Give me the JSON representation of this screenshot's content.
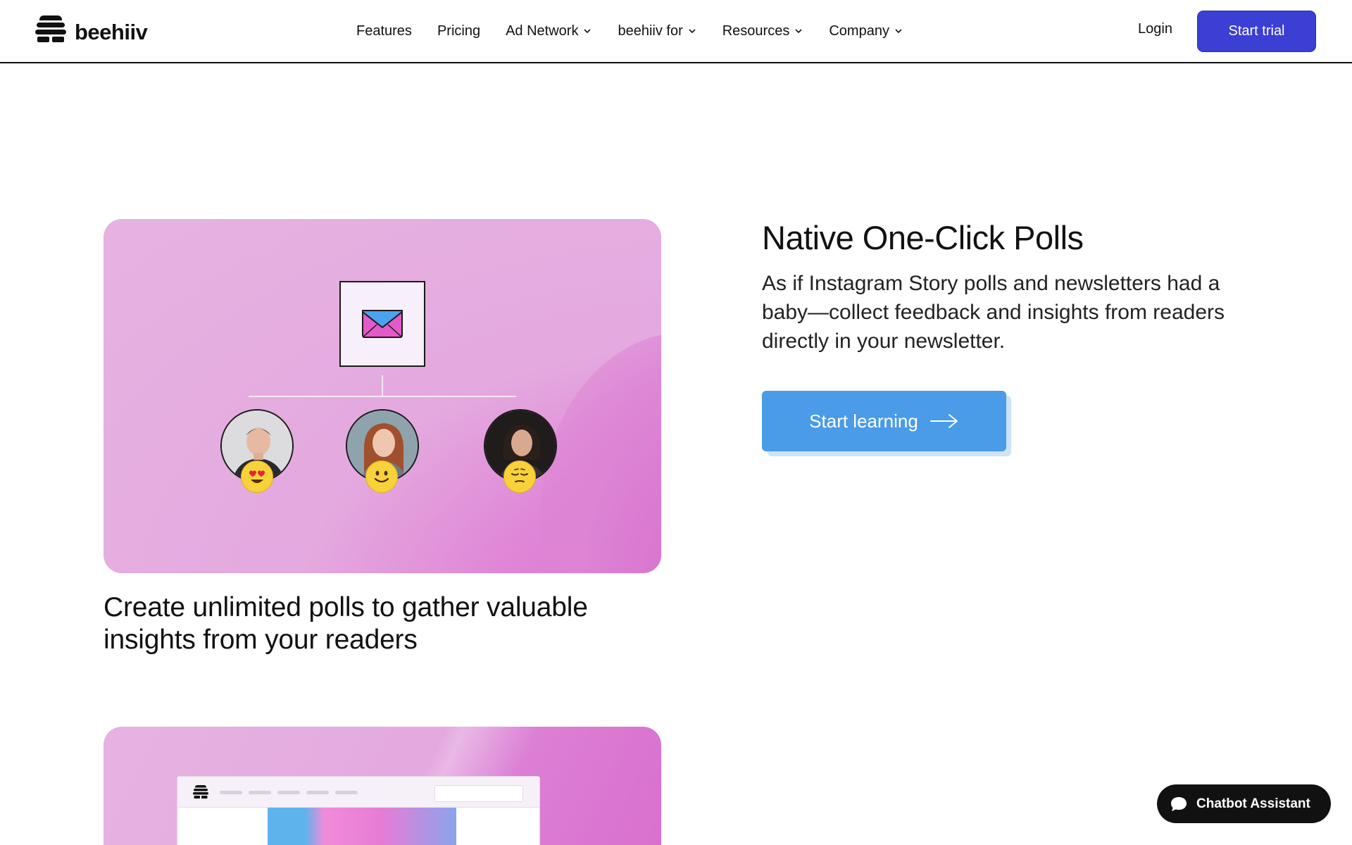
{
  "nav": {
    "logo_text": "beehiiv",
    "links": [
      {
        "label": "Features"
      },
      {
        "label": "Pricing"
      },
      {
        "label": "Ad Network",
        "dropdown": true
      },
      {
        "label": "beehiiv for",
        "dropdown": true
      },
      {
        "label": "Resources",
        "dropdown": true
      },
      {
        "label": "Company",
        "dropdown": true
      }
    ],
    "login_label": "Login",
    "start_trial_label": "Start trial"
  },
  "feature": {
    "title": "Native One-Click Polls",
    "description": "As if Instagram Story polls and newsletters had a baby—collect feedback and insights from readers directly in your newsletter.",
    "cta_label": "Start learning",
    "card_caption": "Create unlimited polls to gather valuable insights from your readers",
    "reactions": [
      "heart-eyes-emoji",
      "smile-emoji",
      "pensive-emoji"
    ]
  },
  "chatbot": {
    "label": "Chatbot Assistant"
  },
  "colors": {
    "brand": "#3b3fd3",
    "cta": "#4a9be8",
    "card_pink": "#e4a9df"
  }
}
